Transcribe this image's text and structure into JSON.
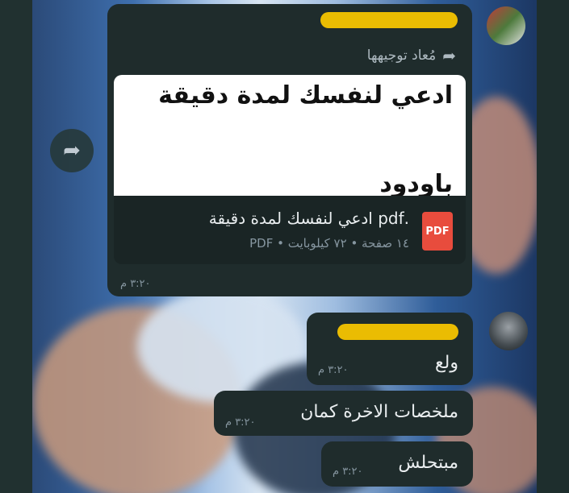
{
  "message1": {
    "forwarded_label": "مُعاد توجيهها",
    "preview_text": "ادعي لنفسك لمدة دقيقة",
    "preview_cut_text": "باودود",
    "file_name": ".pdf ادعي لنفسك لمدة دقيقة",
    "file_meta": "١٤ صفحة • ٧٢ كيلوبايت • PDF",
    "pdf_badge": "PDF",
    "time": "٣:٢٠ م"
  },
  "message2": {
    "text": "ولع",
    "time": "٣:٢٠ م"
  },
  "message3": {
    "text": "ملخصات الاخرة كمان",
    "time": "٣:٢٠ م"
  },
  "message4": {
    "text": "مبتحلش",
    "time": "٣:٢٠ م"
  },
  "icons": {
    "forward": "forward-arrow-icon",
    "share": "share-arrow-icon",
    "pdf": "pdf-file-icon"
  },
  "colors": {
    "bubble": "#1f2c2c",
    "sender_highlight": "#f5c400",
    "pdf_red": "#e84c3d"
  }
}
